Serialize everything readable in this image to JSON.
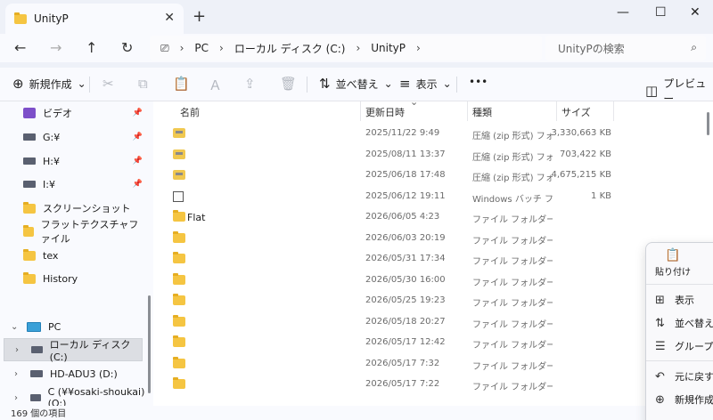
{
  "window": {
    "tab_title": "UnityP",
    "close_glyph": "✕",
    "new_tab_glyph": "+",
    "minimize_glyph": "—",
    "maximize_glyph": "☐",
    "close_window_glyph": "✕"
  },
  "nav_buttons": {
    "back": "←",
    "forward": "→",
    "up": "↑",
    "refresh": "↻"
  },
  "address": {
    "root_glyph": "⎚",
    "crumbs": [
      "PC",
      "ローカル ディスク (C:)",
      "UnityP"
    ],
    "sep": "›"
  },
  "search": {
    "placeholder": "UnityPの検索",
    "icon": "⌕"
  },
  "commands": {
    "new_label": "新規作成",
    "new_icon": "⊕",
    "dropdown": "⌄",
    "cut_icon": "✂",
    "copy_icon": "⧉",
    "paste_icon": "📋",
    "rename_icon": "Ａ",
    "share_icon": "⇪",
    "delete_icon": "🗑",
    "sort_label": "並べ替え",
    "sort_icon": "⇅",
    "view_label": "表示",
    "view_icon": "≡",
    "more_icon": "•••",
    "preview_label": "プレビュー",
    "preview_icon": "◫"
  },
  "sidebar": {
    "items": [
      {
        "label": "ビデオ",
        "icon": "video-icon",
        "pinned": true
      },
      {
        "label": "G:¥",
        "icon": "drive-icon",
        "pinned": true
      },
      {
        "label": "H:¥",
        "icon": "drive-icon",
        "pinned": true
      },
      {
        "label": "I:¥",
        "icon": "drive-icon",
        "pinned": true
      },
      {
        "label": "スクリーンショット",
        "icon": "folder-icon",
        "pinned": false
      },
      {
        "label": "フラットテクスチャファイル",
        "icon": "folder-icon",
        "pinned": false
      },
      {
        "label": "tex",
        "icon": "folder-icon",
        "pinned": false
      },
      {
        "label": "History",
        "icon": "folder-icon",
        "pinned": false
      }
    ],
    "pin_glyph": "📌",
    "pc_label": "PC",
    "drives": [
      {
        "label": "ローカル ディスク (C:)",
        "selected": true
      },
      {
        "label": "HD-ADU3 (D:)",
        "selected": false
      },
      {
        "label": "C (¥¥osaki-shoukai) (O:)",
        "selected": false
      }
    ],
    "expand_glyph": "›",
    "collapse_glyph": "⌄"
  },
  "columns": {
    "name": "名前",
    "date": "更新日時",
    "type": "種類",
    "size": "サイズ",
    "sort_glyph": "⌄"
  },
  "files": [
    {
      "name": "",
      "date": "2025/11/22 9:49",
      "type": "圧縮 (zip 形式) フォ...",
      "size": "3,330,663 KB",
      "icon": "zip"
    },
    {
      "name": "",
      "date": "2025/08/11 13:37",
      "type": "圧縮 (zip 形式) フォ...",
      "size": "703,422 KB",
      "icon": "zip"
    },
    {
      "name": "",
      "date": "2025/06/18 17:48",
      "type": "圧縮 (zip 形式) フォ...",
      "size": "4,675,215 KB",
      "icon": "zip"
    },
    {
      "name": "",
      "date": "2025/06/12 19:11",
      "type": "Windows バッチ ファ...",
      "size": "1 KB",
      "icon": "bat"
    },
    {
      "name": "Flat",
      "date": "2026/06/05 4:23",
      "type": "ファイル フォルダー",
      "size": "",
      "icon": "folder"
    },
    {
      "name": "",
      "date": "2026/06/03 20:19",
      "type": "ファイル フォルダー",
      "size": "",
      "icon": "folder"
    },
    {
      "name": "",
      "date": "2026/05/31 17:34",
      "type": "ファイル フォルダー",
      "size": "",
      "icon": "folder"
    },
    {
      "name": "",
      "date": "2026/05/30 16:00",
      "type": "ファイル フォルダー",
      "size": "",
      "icon": "folder"
    },
    {
      "name": "",
      "date": "2026/05/25 19:23",
      "type": "ファイル フォルダー",
      "size": "",
      "icon": "folder"
    },
    {
      "name": "",
      "date": "2026/05/18 20:27",
      "type": "ファイル フォルダー",
      "size": "",
      "icon": "folder"
    },
    {
      "name": "",
      "date": "2026/05/17 12:42",
      "type": "ファイル フォルダー",
      "size": "",
      "icon": "folder"
    },
    {
      "name": "",
      "date": "2026/05/17 7:32",
      "type": "ファイル フォルダー",
      "size": "",
      "icon": "folder"
    },
    {
      "name": "",
      "date": "2026/05/17 7:22",
      "type": "ファイル フォルダー",
      "size": "",
      "icon": "folder"
    }
  ],
  "status": {
    "count": "169 個の項目"
  },
  "context_menu": {
    "paste_label": "貼り付け",
    "paste_icon": "📋",
    "items": [
      {
        "label": "表示",
        "icon": "⊞"
      },
      {
        "label": "並べ替え",
        "icon": "⇅"
      },
      {
        "label": "グループで",
        "icon": "☰"
      },
      {
        "label": "元に戻す",
        "icon": "↶"
      },
      {
        "label": "新規作成",
        "icon": "⊕"
      }
    ]
  },
  "colors": {
    "folder": "#f5c542",
    "selected_bg": "#dcdee3",
    "window_bg": "#eef1f8"
  }
}
